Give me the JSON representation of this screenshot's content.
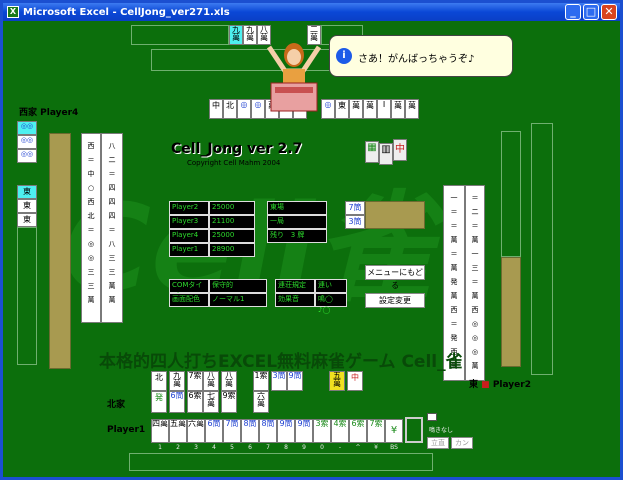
{
  "window": {
    "title": "Microsoft Excel - CellJong_ver271.xls",
    "min_label": "_",
    "max_label": "□",
    "close_label": "✕"
  },
  "game": {
    "title": "Cell_Jong ver 2.7",
    "copyright": "Copyright Cell Mahm 2004",
    "tagline": "本格的四人打ちEXCEL無料麻雀ゲーム Cell_雀",
    "watermark": "Cell雀",
    "speech": "さあ！がんばっちゃうぞ♪",
    "info_icon": "i"
  },
  "players": {
    "west": "西家 Player4",
    "east_wind": "東",
    "east": "Player2",
    "north": "北家",
    "player1": "Player1"
  },
  "scores": [
    {
      "name": "Player2",
      "score": "25000"
    },
    {
      "name": "Player3",
      "score": "21100"
    },
    {
      "name": "Player4",
      "score": "25000"
    },
    {
      "name": "Player1",
      "score": "28900"
    }
  ],
  "round": {
    "wind": "東場",
    "hand": "一局",
    "remaining_label": "残り",
    "remaining": "3",
    "remaining_unit": "牌"
  },
  "settings": [
    {
      "label": "COMタイプ",
      "value": "保守的"
    },
    {
      "label": "連荘規定",
      "value": "連い"
    },
    {
      "label": "画面配色",
      "value": "ノーマル1"
    },
    {
      "label": "効果音",
      "value": "鳴◯ ♪◯"
    }
  ],
  "buttons": {
    "menu": "メニューにもどる",
    "settings": "設定変更",
    "riichi": "立直",
    "kan": "カン",
    "stop": "鳴きなし"
  },
  "dora": [
    "7筒",
    "3筒"
  ],
  "hand_keys": [
    "1",
    "2",
    "3",
    "4",
    "5",
    "6",
    "7",
    "8",
    "9",
    "0",
    "-",
    "^",
    "¥",
    "BS"
  ],
  "player1_tiles": [
    "四萬",
    "五萬",
    "六萬",
    "6筒",
    "7筒",
    "8筒",
    "8筒",
    "9筒",
    "9筒",
    "3索",
    "4索",
    "6索",
    "7索",
    "¥"
  ],
  "player1_melds": [
    "北",
    "九萬",
    "7索",
    "八萬",
    "八萬",
    "1索",
    "3筒",
    "9筒",
    "五萬",
    "中"
  ],
  "player1_melds2": [
    "発",
    "6筒",
    "6索",
    "七萬",
    "9索",
    "六萬"
  ],
  "colors": {
    "felt": "#0c6f0c",
    "tile": "#ffffff",
    "panel": "#000000",
    "panel_text": "#2ddc2d",
    "accent": "#1b4fd0"
  }
}
